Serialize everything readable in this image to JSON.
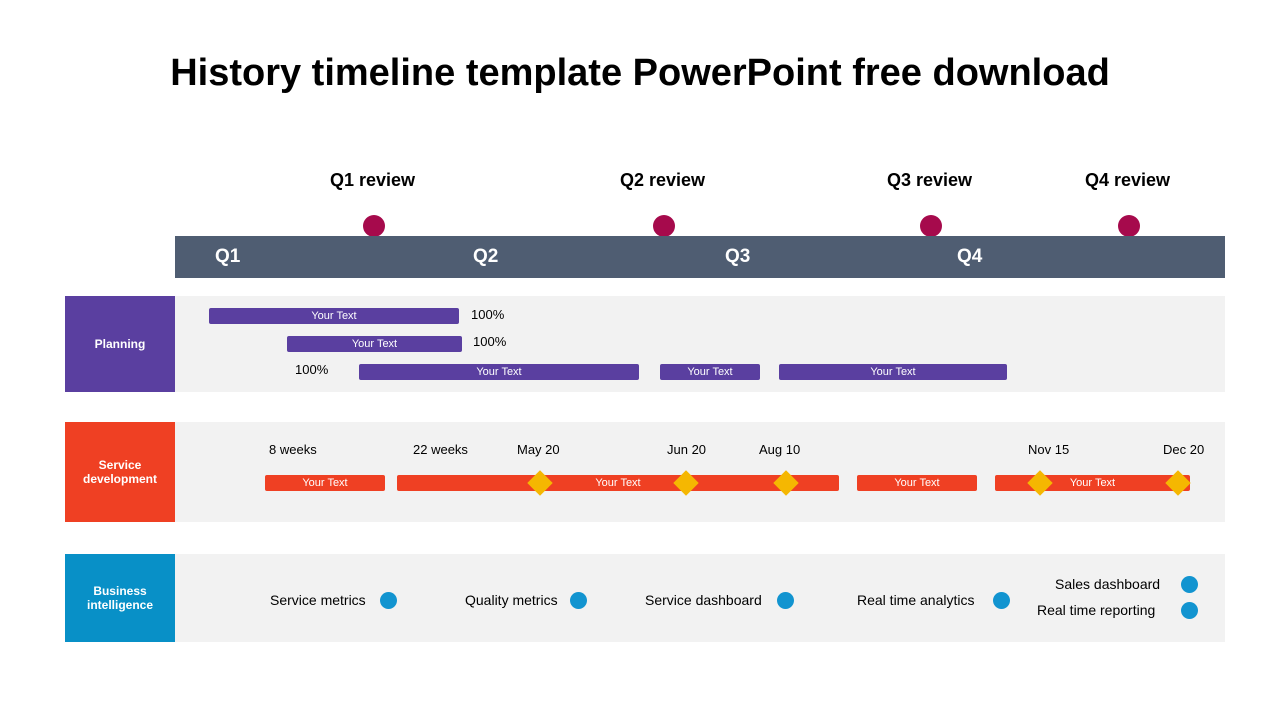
{
  "title": "History timeline template PowerPoint free download",
  "quarters": {
    "q1": "Q1",
    "q2": "Q2",
    "q3": "Q3",
    "q4": "Q4"
  },
  "reviews": {
    "r1": "Q1 review",
    "r2": "Q2 review",
    "r3": "Q3 review",
    "r4": "Q4 review"
  },
  "colors": {
    "header": "#4f5d72",
    "reviewDot": "#a60a4c",
    "planning": "#5a3fa0",
    "service": "#ef4023",
    "business": "#0890c7",
    "diamond": "#f5b701",
    "lane": "#f2f2f2"
  },
  "lanes": {
    "planning": {
      "label": "Planning",
      "bars": {
        "b1": "Your Text",
        "b2": "Your Text",
        "b3": "Your Text",
        "b4": "Your Text",
        "b5": "Your Text"
      },
      "pct": {
        "p1": "100%",
        "p2": "100%",
        "p3": "100%"
      }
    },
    "service": {
      "label": "Service development",
      "bars": {
        "b1": "Your Text",
        "b2": "Your Text",
        "b3": "Your Text",
        "b4": "Your Text"
      },
      "dates": {
        "d1": "8 weeks",
        "d2": "22 weeks",
        "d3": "May 20",
        "d4": "Jun 20",
        "d5": "Aug 10",
        "d6": "Nov 15",
        "d7": "Dec 20"
      }
    },
    "business": {
      "label": "Business intelligence",
      "items": {
        "i1": "Service metrics",
        "i2": "Quality metrics",
        "i3": "Service dashboard",
        "i4": "Real time analytics",
        "i5": "Sales dashboard",
        "i6": "Real time reporting"
      }
    }
  }
}
